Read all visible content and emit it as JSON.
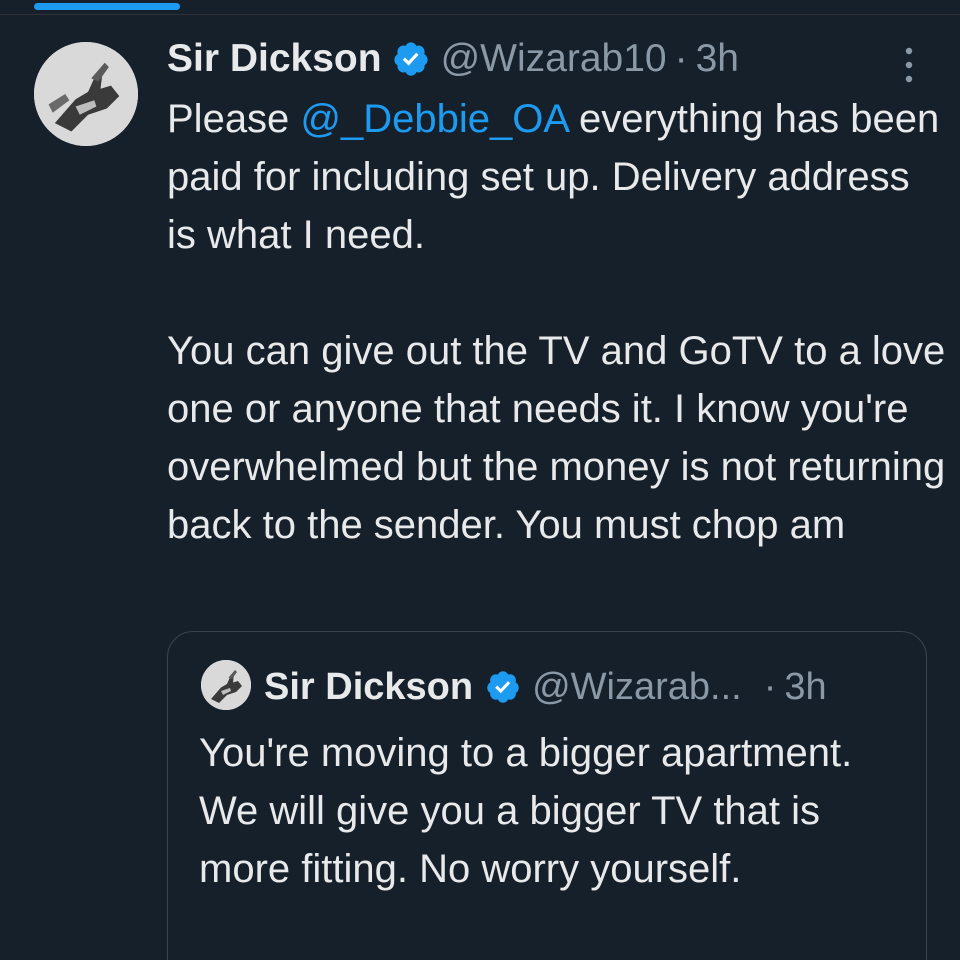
{
  "tweet": {
    "author_name": "Sir Dickson",
    "author_handle": "@Wizarab10",
    "separator": "·",
    "time": "3h",
    "avatar_icon": "profile-photo-hand",
    "verified_icon": "verified-badge-icon",
    "more_icon": "more-vertical-icon",
    "text_prefix": "Please ",
    "mention": "@_Debbie_OA",
    "text_rest": " everything has been paid for including set up. Delivery address is what I need.",
    "paragraph2": "You can give out the TV and GoTV to a love one or anyone that needs it. I know you're overwhelmed but the money is not returning back to the sender. You must chop am"
  },
  "quoted_tweet": {
    "author_name": "Sir Dickson",
    "author_handle": "@Wizarab...",
    "separator": "·",
    "time": "3h",
    "text": "You're moving to a bigger apartment. We will give you a bigger TV that is more fitting. No worry yourself."
  },
  "colors": {
    "background": "#15202b",
    "text": "#e7e9ea",
    "secondary": "#8b98a5",
    "accent": "#1d9bf0",
    "border": "#3a444c"
  }
}
